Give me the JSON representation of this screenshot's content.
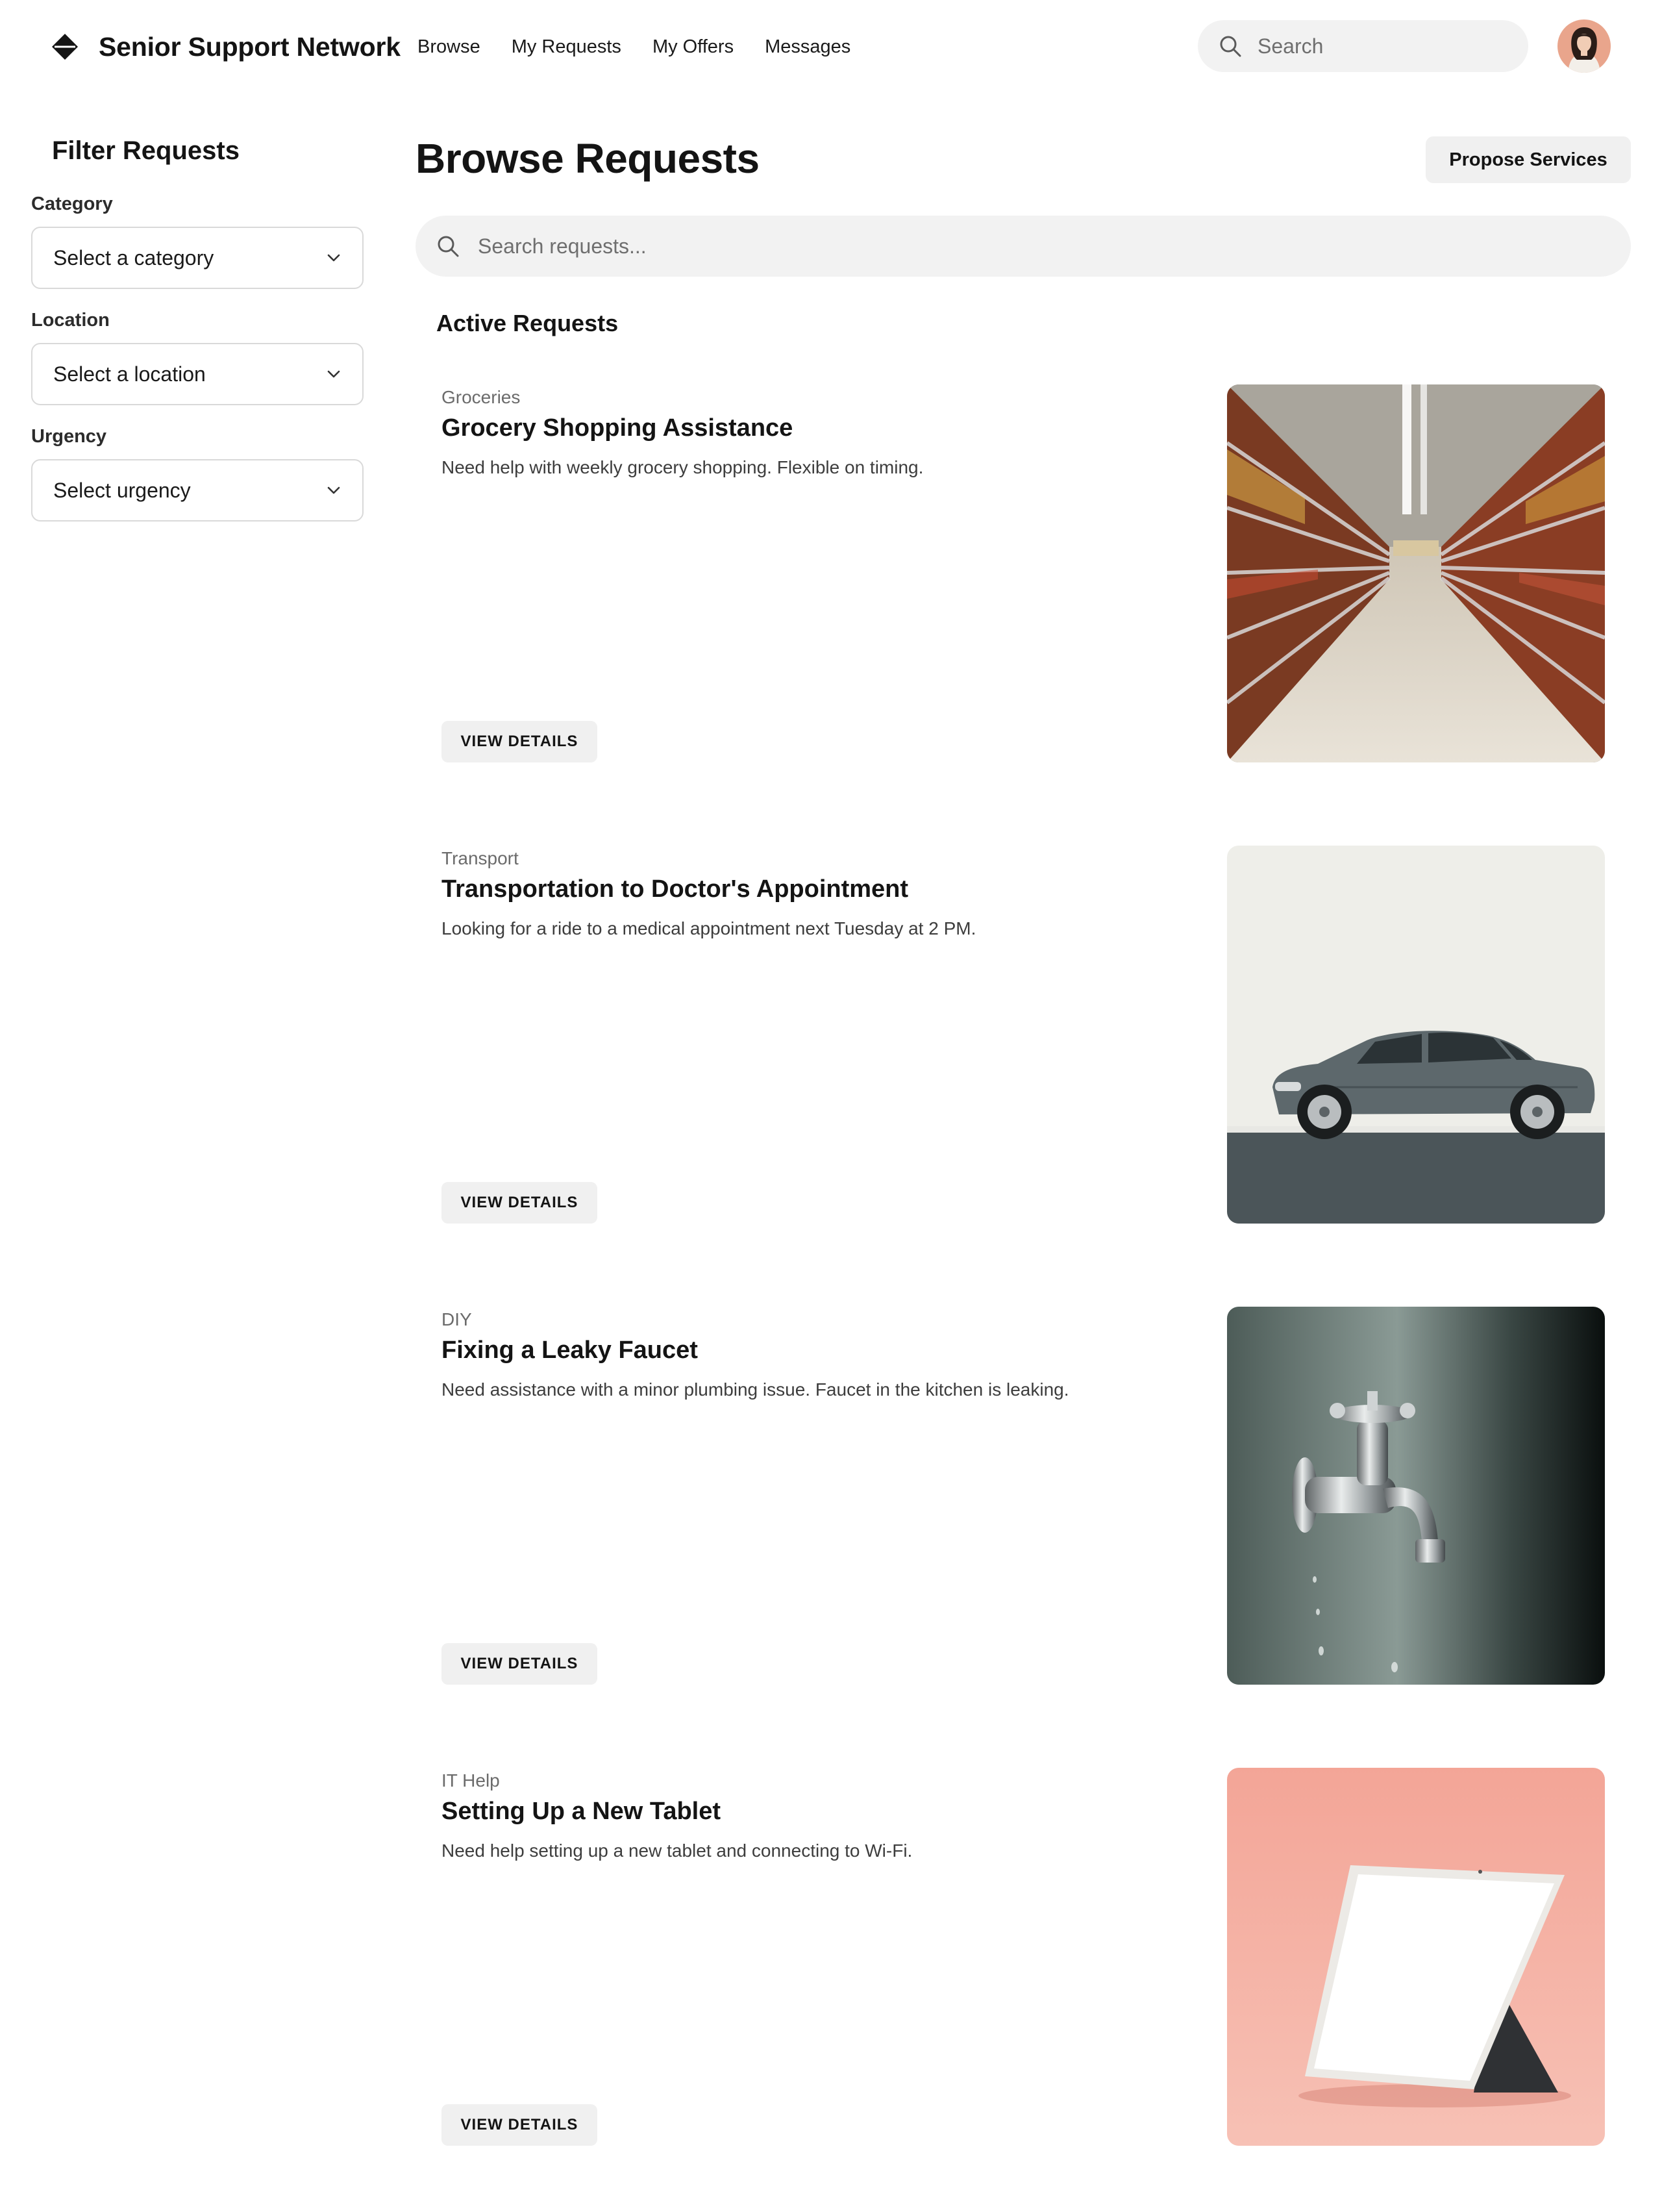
{
  "header": {
    "brand": "Senior Support Network",
    "nav": [
      "Browse",
      "My Requests",
      "My Offers",
      "Messages"
    ],
    "search_placeholder": "Search"
  },
  "sidebar": {
    "title": "Filter Requests",
    "filters": [
      {
        "label": "Category",
        "value": "Select a category"
      },
      {
        "label": "Location",
        "value": "Select a location"
      },
      {
        "label": "Urgency",
        "value": "Select urgency"
      }
    ]
  },
  "main": {
    "title": "Browse Requests",
    "propose_label": "Propose Services",
    "search_placeholder": "Search requests...",
    "section_title": "Active Requests",
    "requests": [
      {
        "category": "Groceries",
        "title": "Grocery Shopping Assistance",
        "description": "Need help with weekly grocery shopping. Flexible on timing.",
        "button": "VIEW DETAILS",
        "image": "grocery-aisle-image"
      },
      {
        "category": "Transport",
        "title": "Transportation to Doctor's Appointment",
        "description": "Looking for a ride to a medical appointment next Tuesday at 2 PM.",
        "button": "VIEW DETAILS",
        "image": "car-image"
      },
      {
        "category": "DIY",
        "title": "Fixing a Leaky Faucet",
        "description": "Need assistance with a minor plumbing issue. Faucet in the kitchen is leaking.",
        "button": "VIEW DETAILS",
        "image": "faucet-image"
      },
      {
        "category": "IT Help",
        "title": "Setting Up a New Tablet",
        "description": "Need help setting up a new tablet and connecting to Wi-Fi.",
        "button": "VIEW DETAILS",
        "image": "tablet-image"
      }
    ]
  },
  "icons": {
    "logo": "diamond-logo-icon",
    "search": "search-icon",
    "dropdown": "chevron-down-icon"
  },
  "colors": {
    "text": "#141414",
    "muted": "#6b6b6b",
    "button_bg": "#f0f0f0",
    "search_bg": "#f2f2f2",
    "border": "#d9d9d9"
  }
}
